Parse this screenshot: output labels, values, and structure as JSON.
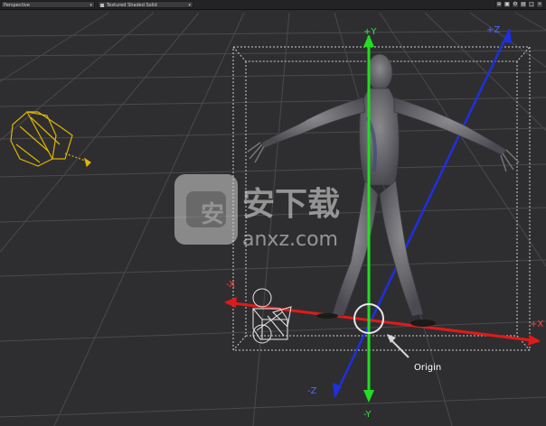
{
  "toolbar": {
    "view_mode": "Perspective",
    "shading_mode": "Textured Shaded Solid"
  },
  "icons": [
    "viewport-options-icon",
    "render-icon",
    "settings-icon",
    "expand-icon",
    "fullscreen-icon",
    "close-icon"
  ],
  "axis_labels": {
    "pos_y": "+Y",
    "neg_y": "-Y",
    "pos_z": "+Z",
    "neg_z": "-Z",
    "pos_x": "+X",
    "neg_x": "-X"
  },
  "annotation": {
    "origin": "Origin"
  },
  "watermark": {
    "site": "anxz.com",
    "name": "安下载"
  },
  "colors": {
    "background": "#2e2e30",
    "grid": "#4a4a4d",
    "y_axis": "#22dd22",
    "z_axis": "#1f2fe0",
    "x_axis": "#e01a1a",
    "light": "#e0b400"
  }
}
